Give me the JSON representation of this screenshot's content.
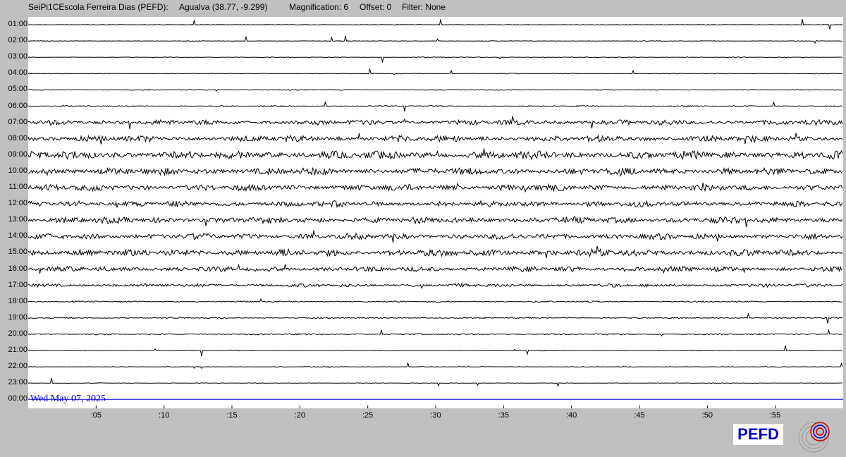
{
  "header": {
    "station": "SeiPi1CEscola Ferreira Dias (PEFD):",
    "location": "Agualva (38.77, -9.299)",
    "magnification": "Magnification: 6",
    "offset": "Offset: 0",
    "filter": "Filter: None"
  },
  "chart_data": {
    "type": "line",
    "hour_labels": [
      "01:00",
      "02:00",
      "03:00",
      "04:00",
      "05:00",
      "06:00",
      "07:00",
      "08:00",
      "09:00",
      "10:00",
      "11:00",
      "12:00",
      "13:00",
      "14:00",
      "15:00",
      "16:00",
      "17:00",
      "18:00",
      "19:00",
      "20:00",
      "21:00",
      "22:00",
      "23:00",
      "00:00"
    ],
    "minute_labels": [
      ":05",
      ":10",
      ":15",
      ":20",
      ":25",
      ":30",
      ":35",
      ":40",
      ":45",
      ":50",
      ":55"
    ],
    "minute_ticks": [
      5,
      10,
      15,
      20,
      25,
      30,
      35,
      40,
      45,
      50,
      55
    ],
    "x_range": [
      0,
      60
    ],
    "trace_color": "#000000",
    "current_line_color": "#0000cc",
    "activity_level": [
      0.05,
      0.05,
      0.06,
      0.06,
      0.08,
      0.12,
      0.45,
      0.55,
      0.7,
      0.6,
      0.55,
      0.5,
      0.55,
      0.5,
      0.6,
      0.45,
      0.3,
      0.12,
      0.12,
      0.12,
      0.08,
      0.06,
      0.05,
      0
    ]
  },
  "footer": {
    "date": "Wed May 07, 2025",
    "logo_text": "PEFD"
  }
}
